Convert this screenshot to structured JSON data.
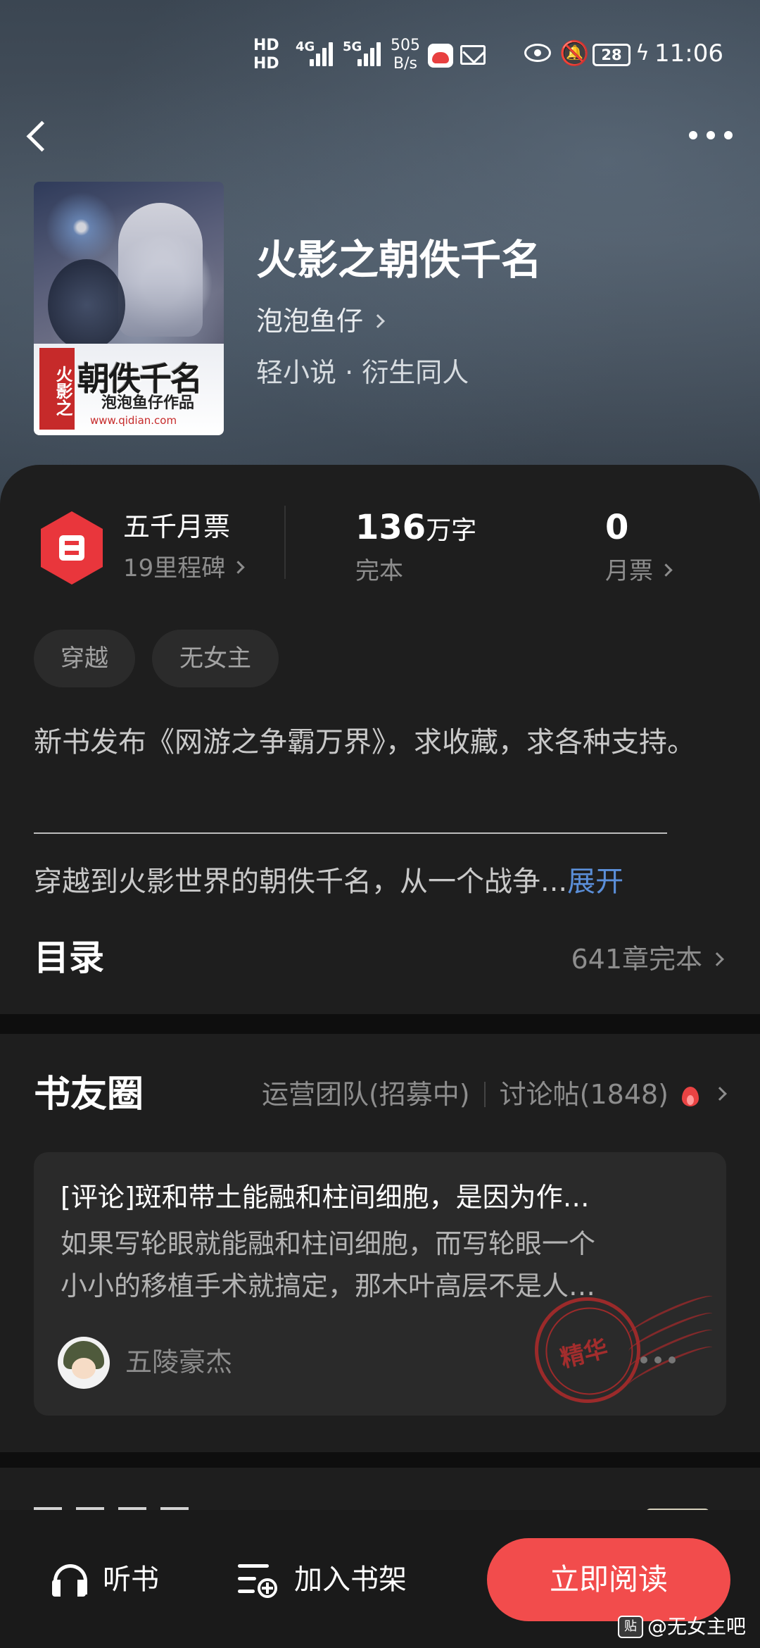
{
  "status_bar": {
    "hd1": "HD",
    "hd2": "HD",
    "net1": "4G",
    "net2": "5G",
    "speed_value": "505",
    "speed_unit": "B/s",
    "battery": "28",
    "time": "11:06"
  },
  "book": {
    "title": "火影之朝佚千名",
    "author": "泡泡鱼仔",
    "genre": "轻小说 · 衍生同人",
    "cover": {
      "side_text": "火影之",
      "title": "朝佚千名",
      "author": "泡泡鱼仔作品",
      "url": "www.qidian.com"
    }
  },
  "stats": {
    "ticket_title": "五千月票",
    "ticket_sub": "19里程碑",
    "word_count": "136",
    "word_unit": "万字",
    "status": "完本",
    "monthly_votes": "0",
    "monthly_label": "月票"
  },
  "tags": [
    "穿越",
    "无女主"
  ],
  "description": {
    "line1": "新书发布《网游之争霸万界》，求收藏，求各种支持。",
    "line2": "穿越到火影世界的朝佚千名，从一个战争...",
    "expand": "展开"
  },
  "toc": {
    "title": "目录",
    "info": "641章完本"
  },
  "circle": {
    "title": "书友圈",
    "link1": "运营团队(招募中)",
    "link2": "讨论帖(1848)",
    "post": {
      "title": "[评论]斑和带土能融和柱间细胞，是因为作…",
      "body_line1": "如果写轮眼就能融和柱间细胞，而写轮眼一个",
      "body_line2": "小小的移植手术就搞定，那木叶高层不是人…",
      "user": "五陵豪杰",
      "stamp": "精华"
    }
  },
  "bottom_bar": {
    "listen": "听书",
    "add_shelf": "加入书架",
    "read_now": "立即阅读"
  },
  "watermark": {
    "logo": "贴",
    "text": "@无女主吧"
  },
  "colors": {
    "accent_red": "#f24c4c",
    "link_blue": "#5b8fd9",
    "panel_bg": "#1e1e1e"
  }
}
